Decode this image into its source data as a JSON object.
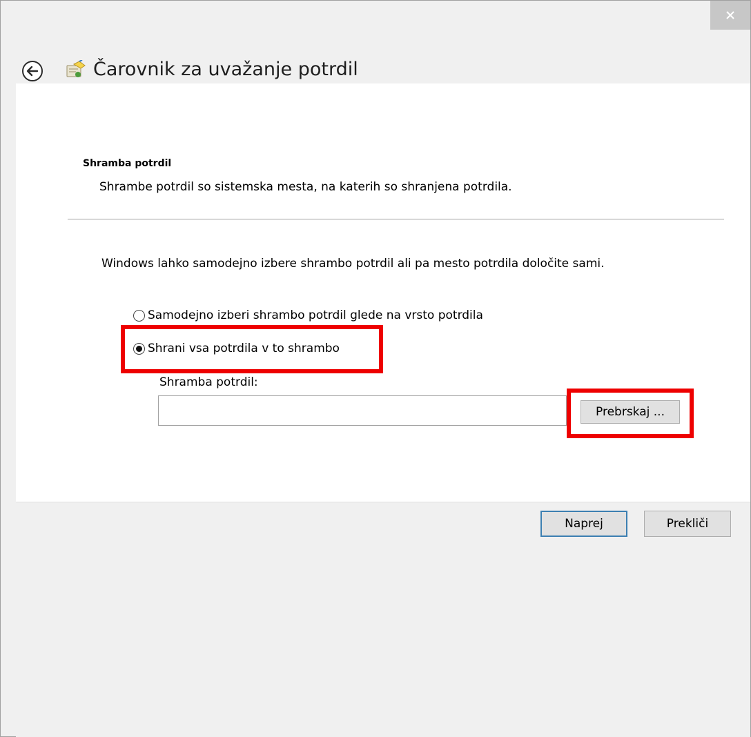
{
  "window": {
    "title": "Čarovnik za uvažanje potrdil",
    "close_icon": "close-icon"
  },
  "page": {
    "section_heading": "Shramba potrdil",
    "section_description": "Shrambe potrdil so sistemska mesta, na katerih so shranjena potrdila.",
    "intro_text": "Windows lahko samodejno izbere shrambo potrdil ali pa mesto potrdila določite sami.",
    "options": [
      {
        "label": "Samodejno izberi shrambo potrdil glede na vrsto potrdila",
        "selected": false
      },
      {
        "label": "Shrani vsa potrdila v to shrambo",
        "selected": true
      }
    ],
    "store_label": "Shramba potrdil:",
    "store_value": "",
    "browse_label": "Prebrskaj ..."
  },
  "footer": {
    "next_label": "Naprej",
    "cancel_label": "Prekliči"
  },
  "colors": {
    "highlight": "#ee0000",
    "default_button_border": "#3c7fb1",
    "chrome_background": "#f0f0f0"
  }
}
